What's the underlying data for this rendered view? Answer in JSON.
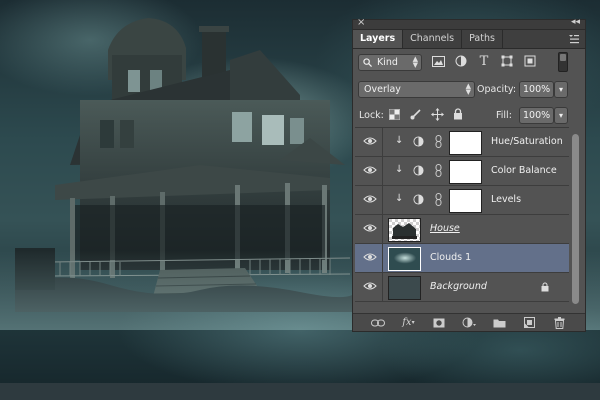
{
  "panel": {
    "tabs": [
      {
        "label": "Layers",
        "active": true
      },
      {
        "label": "Channels",
        "active": false
      },
      {
        "label": "Paths",
        "active": false
      }
    ],
    "filter": {
      "kind_label": "Kind",
      "icons": [
        "image-filter-icon",
        "adjustment-filter-icon",
        "type-filter-icon",
        "shape-filter-icon",
        "smart-object-filter-icon"
      ]
    },
    "blend_mode": "Overlay",
    "opacity_label": "Opacity:",
    "opacity_value": "100%",
    "lock_label": "Lock:",
    "fill_label": "Fill:",
    "fill_value": "100%",
    "layers": [
      {
        "name": "Hue/Saturation",
        "type": "adjustment",
        "visible": true
      },
      {
        "name": "Color Balance",
        "type": "adjustment",
        "visible": true
      },
      {
        "name": "Levels",
        "type": "adjustment",
        "visible": true
      },
      {
        "name": "House",
        "type": "pixel",
        "visible": true
      },
      {
        "name": "Clouds 1",
        "type": "pixel",
        "visible": true,
        "selected": true
      },
      {
        "name": "Background",
        "type": "background",
        "visible": true,
        "locked": true
      }
    ],
    "bottom_icons": [
      "link-layers-icon",
      "fx-icon",
      "add-mask-icon",
      "new-adjustment-icon",
      "new-group-icon",
      "new-layer-icon",
      "trash-icon"
    ],
    "fx_label": "fx",
    "colors": {
      "panel_bg": "#535353",
      "selected_row": "#63708a",
      "tab_bar": "#3f3f3f"
    }
  }
}
